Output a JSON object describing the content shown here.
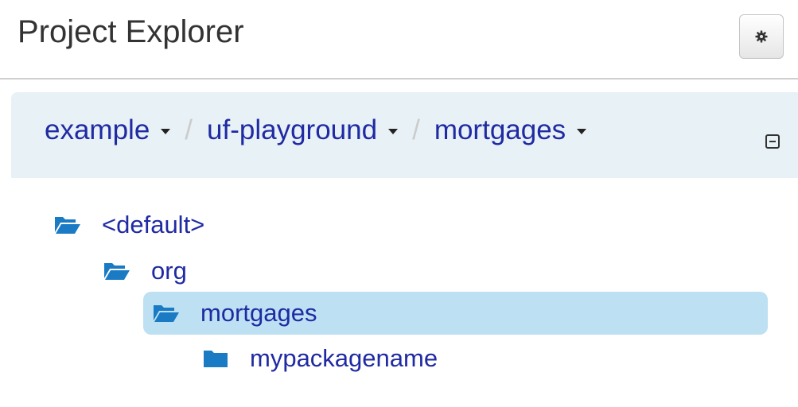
{
  "header": {
    "title": "Project Explorer",
    "settings_icon": "gear-icon"
  },
  "breadcrumb": {
    "items": [
      {
        "label": "example"
      },
      {
        "label": "uf-playground"
      },
      {
        "label": "mortgages"
      }
    ],
    "separator": "/",
    "collapse_icon": "collapse-icon"
  },
  "tree": {
    "items": [
      {
        "label": "<default>",
        "icon": "folder-open-icon",
        "selected": false
      },
      {
        "label": "org",
        "icon": "folder-open-icon",
        "selected": false
      },
      {
        "label": "mortgages",
        "icon": "folder-open-icon",
        "selected": true
      },
      {
        "label": "mypackagename",
        "icon": "folder-icon",
        "selected": false
      }
    ]
  },
  "colors": {
    "link": "#1f2aa3",
    "icon": "#1a7bc4",
    "breadcrumb_bg": "#e8f1f6",
    "selected_bg": "#bde0f2"
  }
}
